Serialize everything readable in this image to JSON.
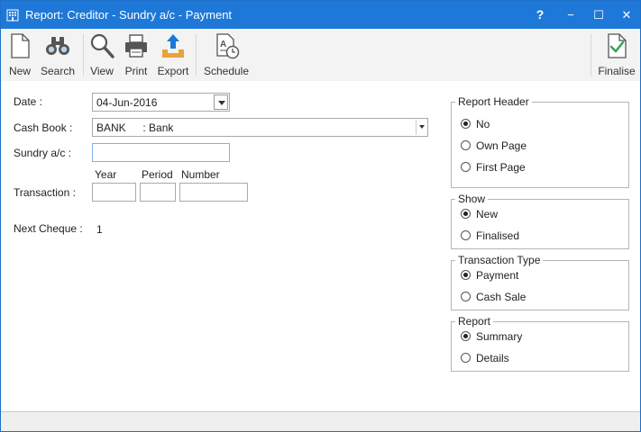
{
  "window": {
    "title": "Report: Creditor - Sundry a/c - Payment"
  },
  "titlebar": {
    "help": "?",
    "minimize": "−",
    "maximize": "☐",
    "close": "✕"
  },
  "toolbar": {
    "new_label": "New",
    "search_label": "Search",
    "view_label": "View",
    "print_label": "Print",
    "export_label": "Export",
    "schedule_label": "Schedule",
    "finalise_label": "Finalise"
  },
  "form": {
    "date_label": "Date :",
    "date_value": "04-Jun-2016",
    "cashbook_label": "Cash Book :",
    "cashbook_code": "BANK",
    "cashbook_name": ": Bank",
    "sundry_label": "Sundry a/c :",
    "sundry_value": "",
    "year_label": "Year",
    "period_label": "Period",
    "number_label": "Number",
    "transaction_label": "Transaction :",
    "year_value": "",
    "period_value": "",
    "number_value": "",
    "next_cheque_label": "Next Cheque :",
    "next_cheque_value": "1"
  },
  "groups": {
    "report_header": {
      "title": "Report Header",
      "options": [
        "No",
        "Own Page",
        "First Page"
      ],
      "selected": "No"
    },
    "show": {
      "title": "Show",
      "options": [
        "New",
        "Finalised"
      ],
      "selected": "New"
    },
    "transaction_type": {
      "title": "Transaction Type",
      "options": [
        "Payment",
        "Cash Sale"
      ],
      "selected": "Payment"
    },
    "report": {
      "title": "Report",
      "options": [
        "Summary",
        "Details"
      ],
      "selected": "Summary"
    }
  },
  "colors": {
    "titlebar": "#1e78d8",
    "toolbar": "#f3f3f3",
    "export_accent": "#e8a33a",
    "finalise_accent": "#3aa35a"
  },
  "icons": {
    "new": "blank-document-icon",
    "search": "binoculars-icon",
    "view": "magnifier-icon",
    "print": "printer-icon",
    "export": "export-tray-icon",
    "schedule": "schedule-document-clock-icon",
    "finalise": "document-check-icon"
  }
}
